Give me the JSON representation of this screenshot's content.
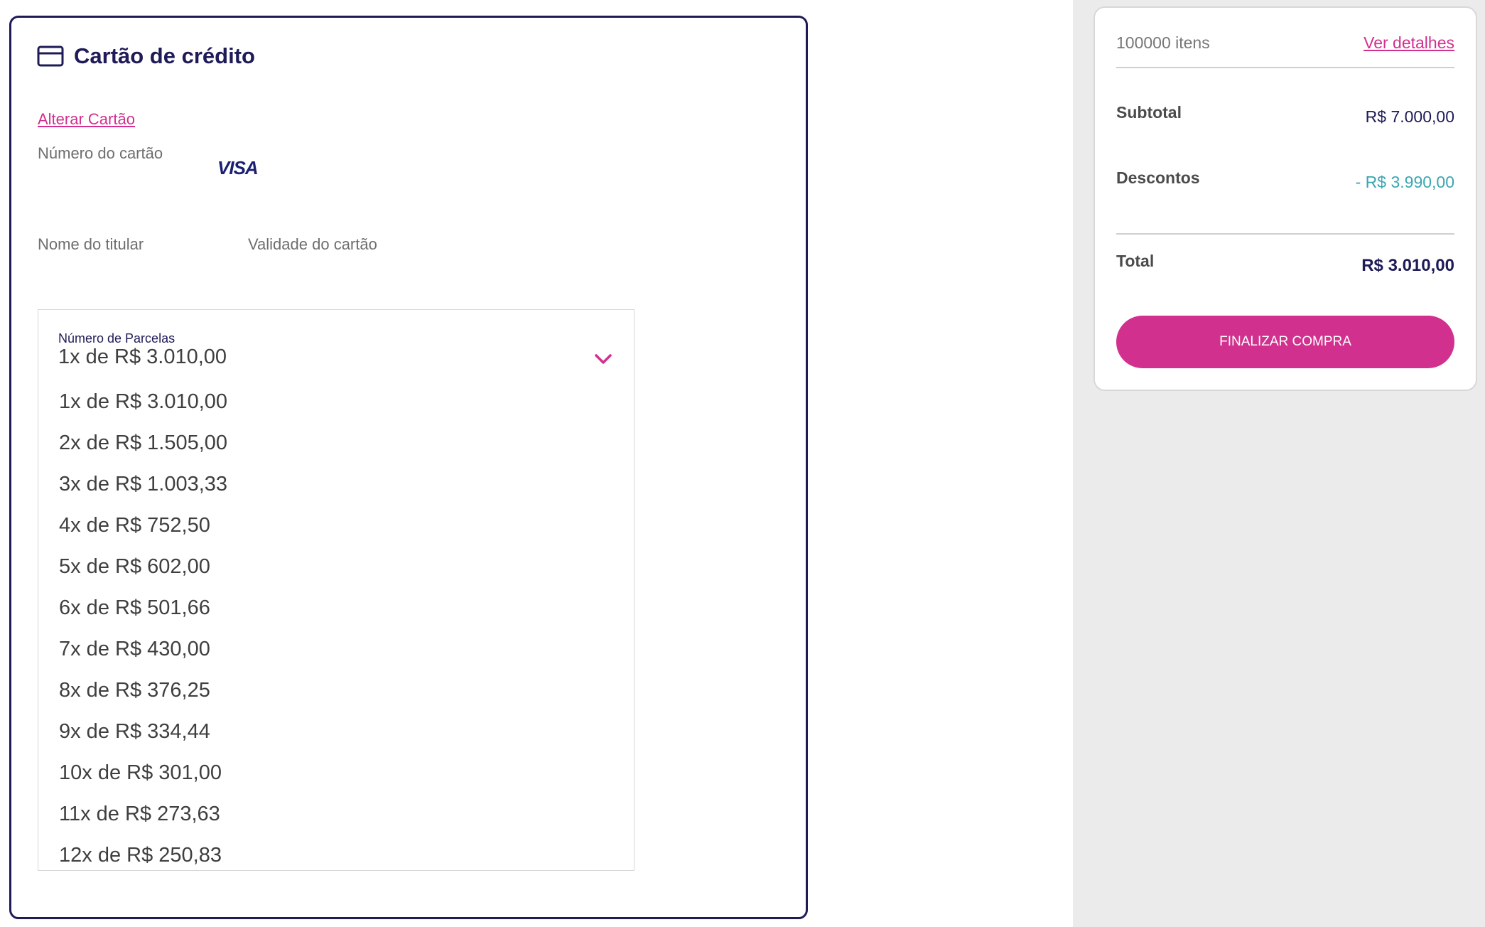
{
  "payment": {
    "title": "Cartão de crédito",
    "change_card_link": "Alterar Cartão",
    "card_number_label": "Número do cartão",
    "card_brand": "VISA",
    "holder_name_label": "Nome do titular",
    "expiry_label": "Validade do cartão"
  },
  "installments": {
    "label": "Número de Parcelas",
    "selected": "1x de R$ 3.010,00",
    "options": [
      "1x de R$ 3.010,00",
      "2x de R$ 1.505,00",
      "3x de R$ 1.003,33",
      "4x de R$ 752,50",
      "5x de R$ 602,00",
      "6x de R$ 501,66",
      "7x de R$ 430,00",
      "8x de R$ 376,25",
      "9x de R$ 334,44",
      "10x de R$ 301,00",
      "11x de R$ 273,63",
      "12x de R$ 250,83"
    ]
  },
  "summary": {
    "items_count": "100000 itens",
    "details_link": "Ver detalhes",
    "subtotal_label": "Subtotal",
    "subtotal_value": "R$ 7.000,00",
    "discount_label": "Descontos",
    "discount_value": "- R$ 3.990,00",
    "total_label": "Total",
    "total_value": "R$ 3.010,00",
    "checkout_button": "FINALIZAR COMPRA"
  },
  "colors": {
    "brand_navy": "#1e1b57",
    "brand_pink": "#d1308e",
    "discount_teal": "#3aa6b1",
    "sidebar_bg": "#ebebeb"
  },
  "icons": [
    "credit-card-icon",
    "chevron-down-icon"
  ]
}
